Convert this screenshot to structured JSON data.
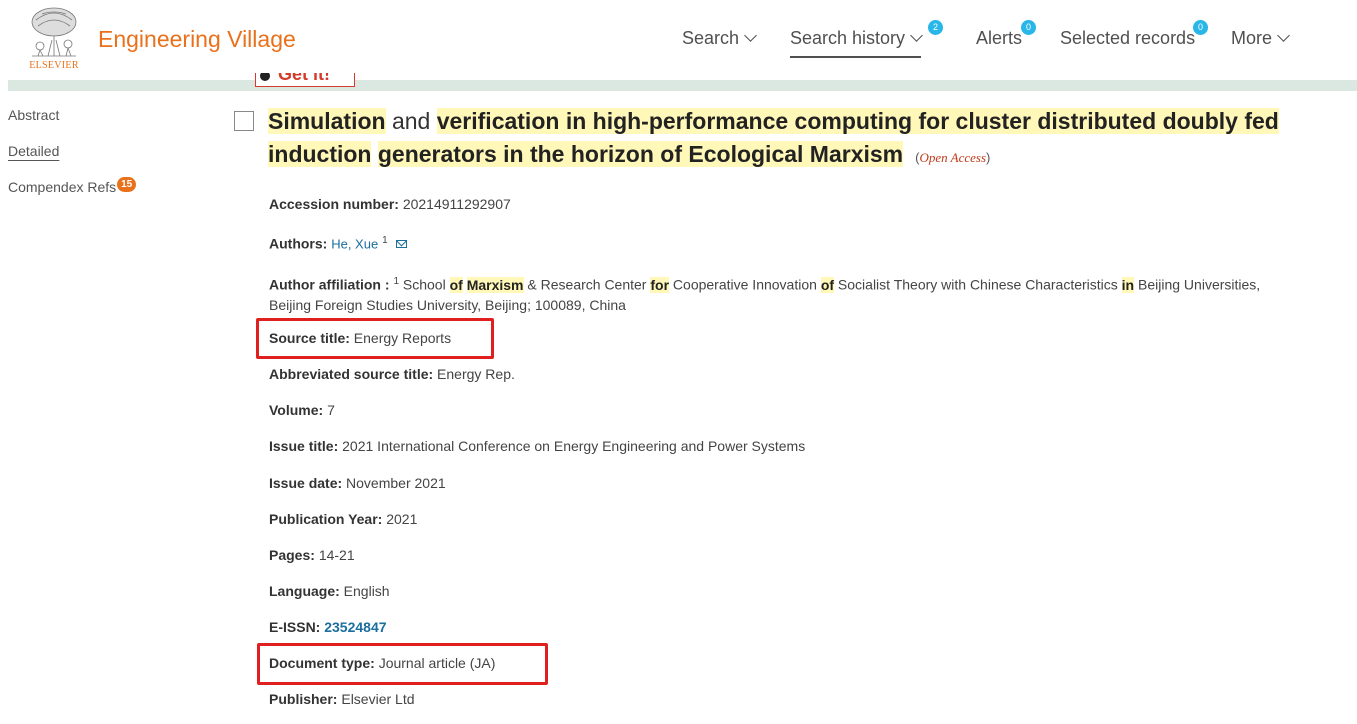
{
  "header": {
    "logo_text": "ELSEVIER",
    "brand": "Engineering Village",
    "nav": [
      {
        "label": "Search",
        "badge": null
      },
      {
        "label": "Search history",
        "badge": "2"
      },
      {
        "label": "Alerts",
        "badge": "0"
      },
      {
        "label": "Selected records",
        "badge": "0"
      },
      {
        "label": "More",
        "badge": null
      }
    ],
    "get_it": "Get it!"
  },
  "sidebar": {
    "items": [
      {
        "label": "Abstract"
      },
      {
        "label": "Detailed"
      },
      {
        "label": "Compendex Refs",
        "badge": "15"
      }
    ]
  },
  "record": {
    "title_parts": [
      "Simulation",
      "and",
      "verification in high-performance computing for cluster distributed doubly fed induction",
      "generators in the horizon of Ecological Marxism"
    ],
    "open_access": "Open Access",
    "accession": {
      "label": "Accession number:",
      "value": "20214911292907"
    },
    "authors": {
      "label": "Authors:",
      "name": "He, Xue",
      "sup": "1"
    },
    "affiliation": {
      "label": "Author affiliation :",
      "sup": "1",
      "parts": [
        "School",
        "of",
        "Marxism",
        "& Research Center",
        "for",
        "Cooperative Innovation",
        "of",
        "Socialist Theory with Chinese Characteristics",
        "in",
        "Beijing Universities,",
        "Beijing Foreign Studies University, Beijing; 100089, China"
      ]
    },
    "source_title": {
      "label": "Source title:",
      "value": "Energy Reports"
    },
    "abbrev_source": {
      "label": "Abbreviated source title:",
      "value": "Energy Rep."
    },
    "volume": {
      "label": "Volume:",
      "value": "7"
    },
    "issue_title": {
      "label": "Issue title:",
      "value": "2021 International Conference on Energy Engineering and Power Systems"
    },
    "issue_date": {
      "label": "Issue date:",
      "value": "November 2021"
    },
    "pub_year": {
      "label": "Publication Year:",
      "value": "2021"
    },
    "pages": {
      "label": "Pages:",
      "value": "14-21"
    },
    "language": {
      "label": "Language:",
      "value": "English"
    },
    "eissn": {
      "label": "E-ISSN:",
      "value": "23524847"
    },
    "doc_type": {
      "label": "Document type:",
      "value": "Journal article (JA)"
    },
    "publisher": {
      "label": "Publisher:",
      "value": "Elsevier Ltd"
    }
  },
  "colors": {
    "brand": "#e9711c",
    "badge": "#29b6e8",
    "highlight": "#fff8b8",
    "annotation": "#e0201f"
  }
}
